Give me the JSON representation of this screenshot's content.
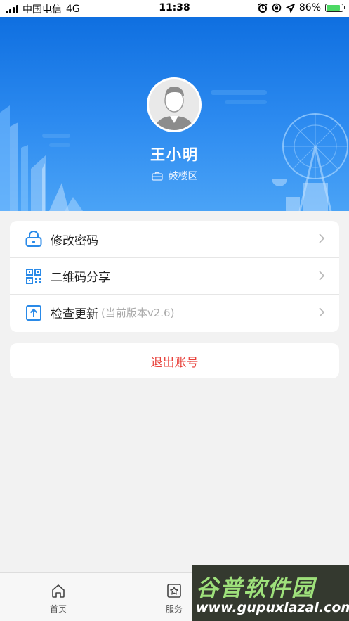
{
  "status_bar": {
    "carrier": "中国电信",
    "network": "4G",
    "time": "11:38",
    "battery_percent": "86%",
    "battery_level": 0.86
  },
  "profile": {
    "name": "王小明",
    "district": "鼓楼区"
  },
  "menu": {
    "change_password": "修改密码",
    "qr_share": "二维码分享",
    "check_update": "检查更新",
    "version_note": "(当前版本v2.6)"
  },
  "logout_label": "退出账号",
  "tabbar": {
    "home": "首页",
    "service": "服务"
  },
  "watermark": {
    "title": "谷普软件园",
    "url": "www.gupuxlazal.com"
  },
  "colors": {
    "header_top": "#0f6fe0",
    "header_bottom": "#4aa3f6",
    "logout_red": "#e8403a",
    "icon_blue": "#2a8ae8"
  }
}
